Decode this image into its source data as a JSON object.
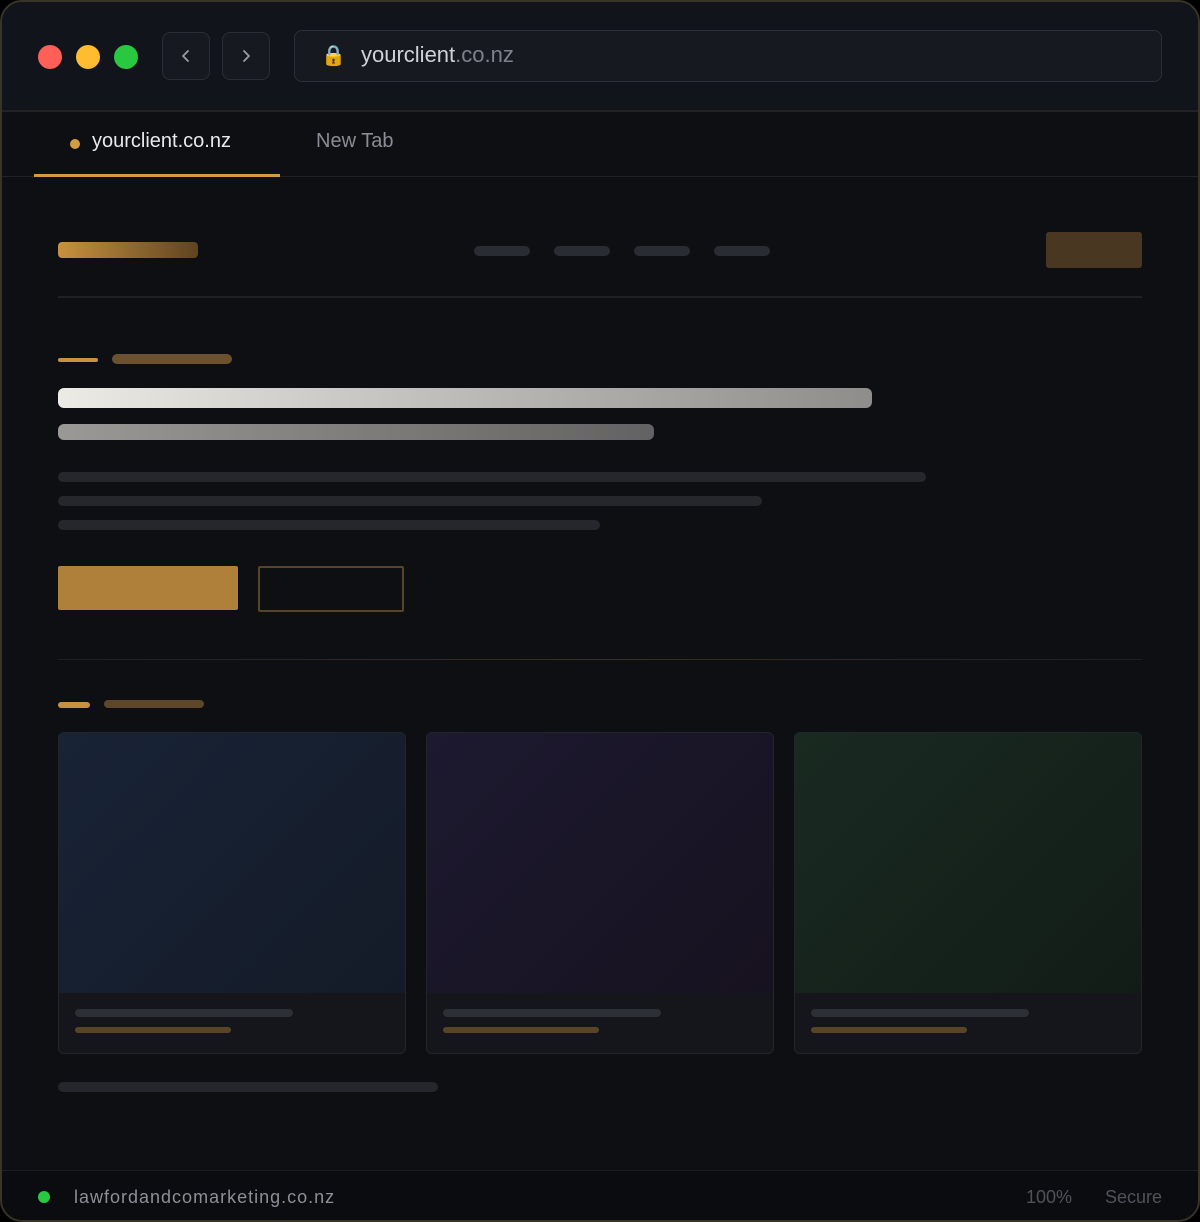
{
  "browser": {
    "url": {
      "host": "yourclient",
      "tld": ".co.nz"
    },
    "tabs": [
      {
        "label": "yourclient.co.nz",
        "active": true
      },
      {
        "label": "New Tab",
        "active": false
      }
    ],
    "icons": {
      "lock": "lock-icon",
      "back": "chevron-left-icon",
      "forward": "chevron-right-icon"
    }
  },
  "status_bar": {
    "host": "lawfordandcomarketing.co.nz",
    "zoom": "100%",
    "security": "Secure"
  },
  "colors": {
    "accent": "#d49b45",
    "background": "#0e0f13",
    "status_online": "#28c840"
  }
}
